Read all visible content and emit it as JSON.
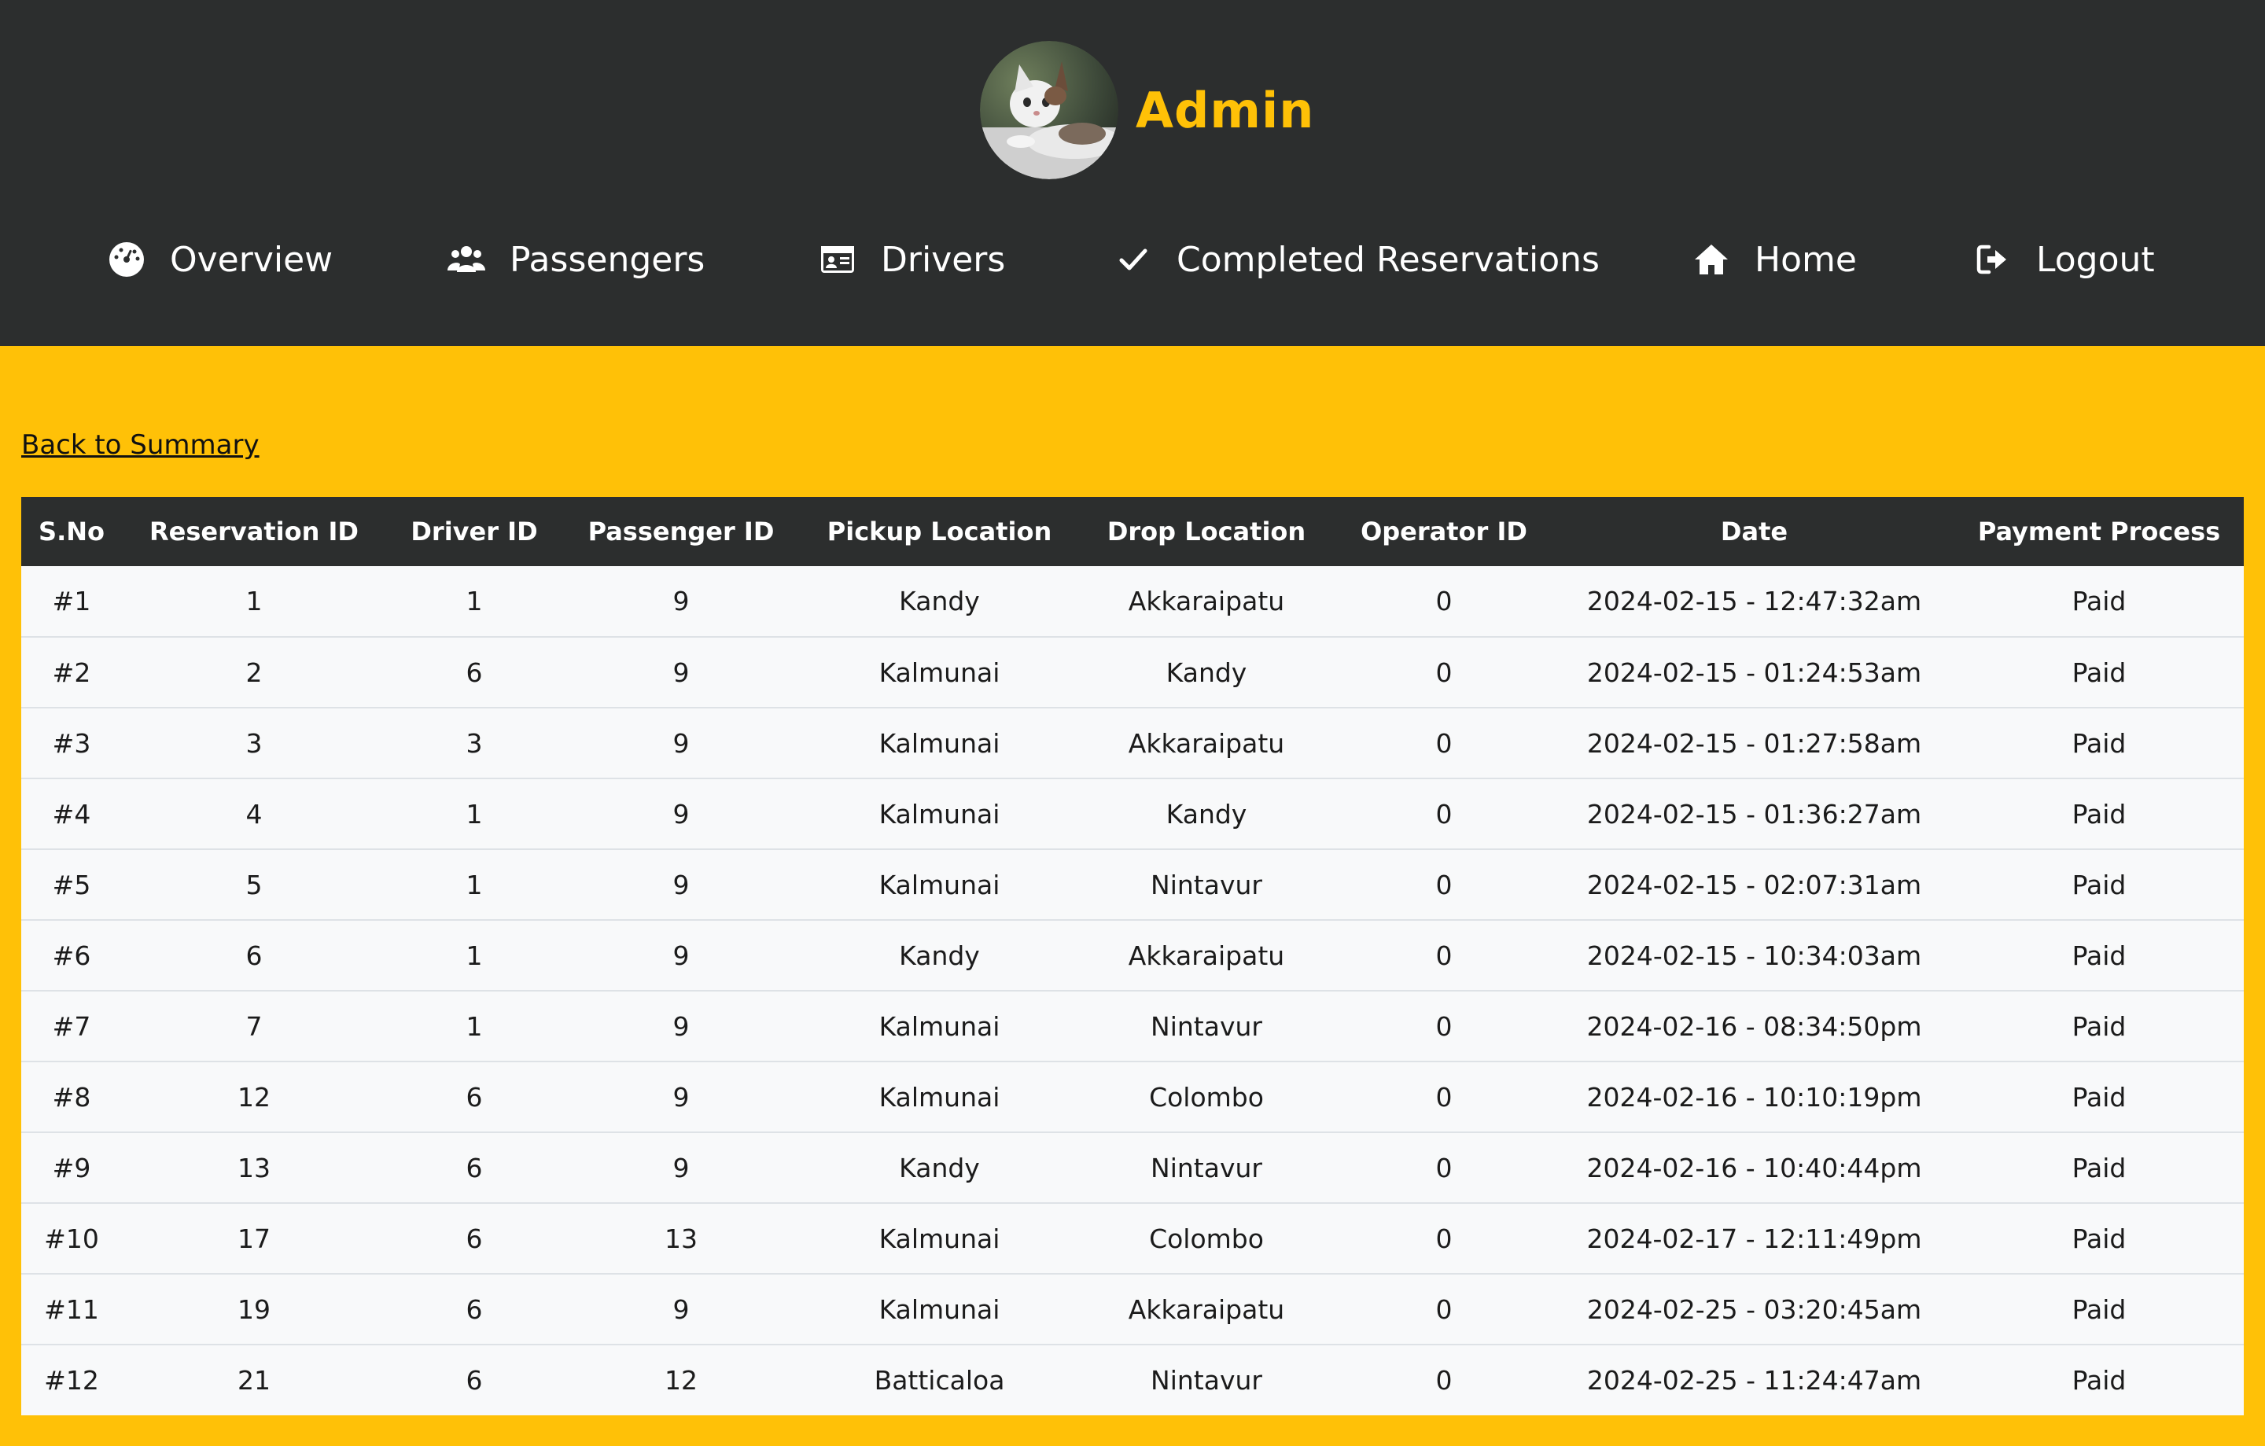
{
  "header": {
    "brand_name": "Admin",
    "avatar_alt": "cat-avatar"
  },
  "nav": {
    "items": [
      {
        "label": "Overview",
        "icon": "gauge-icon"
      },
      {
        "label": "Passengers",
        "icon": "users-icon"
      },
      {
        "label": "Drivers",
        "icon": "id-card-icon"
      },
      {
        "label": "Completed Reservations",
        "icon": "check-icon"
      },
      {
        "label": "Home",
        "icon": "home-icon"
      },
      {
        "label": "Logout",
        "icon": "logout-icon"
      }
    ]
  },
  "back_link": "Back to Summary",
  "table": {
    "columns": [
      "S.No",
      "Reservation ID",
      "Driver ID",
      "Passenger ID",
      "Pickup Location",
      "Drop Location",
      "Operator ID",
      "Date",
      "Payment Process"
    ],
    "rows": [
      [
        "#1",
        "1",
        "1",
        "9",
        "Kandy",
        "Akkaraipatu",
        "0",
        "2024-02-15 - 12:47:32am",
        "Paid"
      ],
      [
        "#2",
        "2",
        "6",
        "9",
        "Kalmunai",
        "Kandy",
        "0",
        "2024-02-15 - 01:24:53am",
        "Paid"
      ],
      [
        "#3",
        "3",
        "3",
        "9",
        "Kalmunai",
        "Akkaraipatu",
        "0",
        "2024-02-15 - 01:27:58am",
        "Paid"
      ],
      [
        "#4",
        "4",
        "1",
        "9",
        "Kalmunai",
        "Kandy",
        "0",
        "2024-02-15 - 01:36:27am",
        "Paid"
      ],
      [
        "#5",
        "5",
        "1",
        "9",
        "Kalmunai",
        "Nintavur",
        "0",
        "2024-02-15 - 02:07:31am",
        "Paid"
      ],
      [
        "#6",
        "6",
        "1",
        "9",
        "Kandy",
        "Akkaraipatu",
        "0",
        "2024-02-15 - 10:34:03am",
        "Paid"
      ],
      [
        "#7",
        "7",
        "1",
        "9",
        "Kalmunai",
        "Nintavur",
        "0",
        "2024-02-16 - 08:34:50pm",
        "Paid"
      ],
      [
        "#8",
        "12",
        "6",
        "9",
        "Kalmunai",
        "Colombo",
        "0",
        "2024-02-16 - 10:10:19pm",
        "Paid"
      ],
      [
        "#9",
        "13",
        "6",
        "9",
        "Kandy",
        "Nintavur",
        "0",
        "2024-02-16 - 10:40:44pm",
        "Paid"
      ],
      [
        "#10",
        "17",
        "6",
        "13",
        "Kalmunai",
        "Colombo",
        "0",
        "2024-02-17 - 12:11:49pm",
        "Paid"
      ],
      [
        "#11",
        "19",
        "6",
        "9",
        "Kalmunai",
        "Akkaraipatu",
        "0",
        "2024-02-25 - 03:20:45am",
        "Paid"
      ],
      [
        "#12",
        "21",
        "6",
        "12",
        "Batticaloa",
        "Nintavur",
        "0",
        "2024-02-25 - 11:24:47am",
        "Paid"
      ]
    ]
  },
  "colors": {
    "header_bg": "#2c2e2e",
    "accent": "#ffc107",
    "row_bg": "#f8f9fa"
  }
}
